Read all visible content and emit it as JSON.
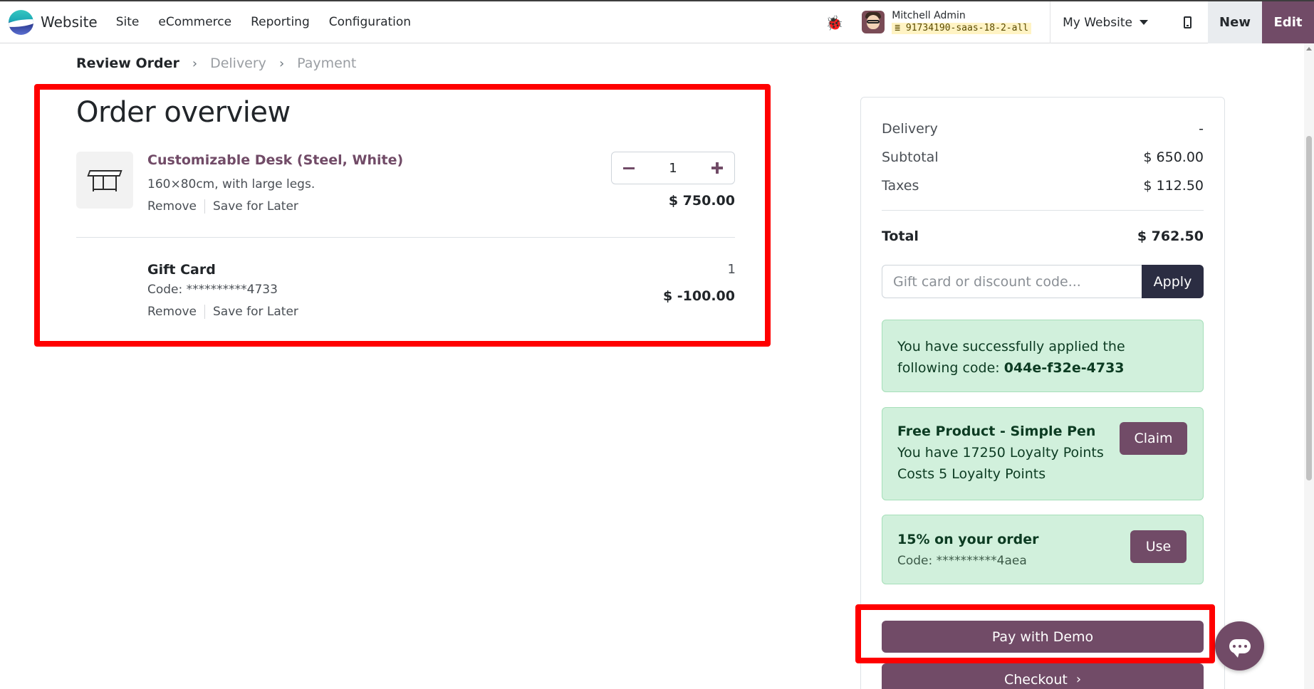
{
  "navbar": {
    "app_name": "Website",
    "menu": [
      "Site",
      "eCommerce",
      "Reporting",
      "Configuration"
    ],
    "user_name": "Mitchell Admin",
    "db_name": "91734190-saas-18-2-all",
    "website_selector": "My Website",
    "new_label": "New",
    "edit_label": "Edit"
  },
  "breadcrumb": {
    "steps": [
      "Review Order",
      "Delivery",
      "Payment"
    ]
  },
  "order": {
    "title": "Order overview",
    "lines": [
      {
        "name": "Customizable Desk (Steel, White)",
        "description": "160×80cm, with large legs.",
        "quantity": "1",
        "price": "$ 750.00",
        "remove_label": "Remove",
        "save_label": "Save for Later"
      },
      {
        "name": "Gift Card",
        "code": "Code: **********4733",
        "quantity": "1",
        "price": "$ -100.00",
        "remove_label": "Remove",
        "save_label": "Save for Later"
      }
    ]
  },
  "summary": {
    "delivery_label": "Delivery",
    "delivery_value": "-",
    "subtotal_label": "Subtotal",
    "subtotal_value": "$ 650.00",
    "taxes_label": "Taxes",
    "taxes_value": "$ 112.50",
    "total_label": "Total",
    "total_value": "$ 762.50",
    "code_placeholder": "Gift card or discount code...",
    "apply_label": "Apply",
    "applied_text": "You have successfully applied the following code:",
    "applied_code": "044e-f32e-4733",
    "reward_1": {
      "title": "Free Product - Simple Pen",
      "line1": "You have 17250 Loyalty Points",
      "line2": "Costs 5 Loyalty Points",
      "button": "Claim"
    },
    "reward_2": {
      "title": "15% on your order",
      "code": "Code: **********4aea",
      "button": "Use"
    },
    "pay_label": "Pay with Demo",
    "checkout_label": "Checkout"
  },
  "colors": {
    "brand": "#714b67",
    "highlight": "#ff0000",
    "success_bg": "#d1f0dc",
    "apply_btn": "#2b2d42"
  }
}
